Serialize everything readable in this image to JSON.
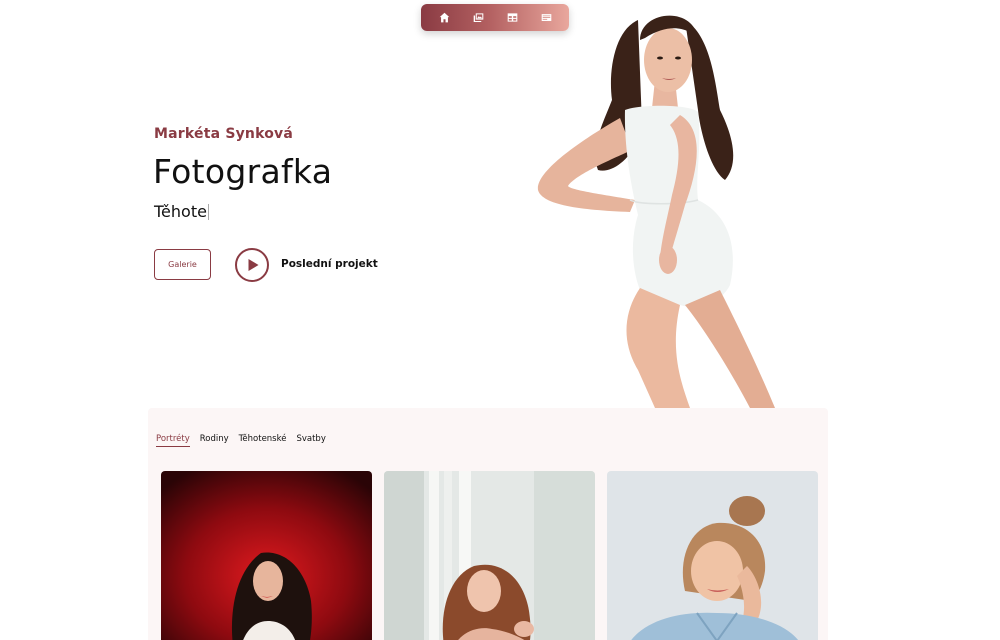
{
  "nav": {
    "items": [
      {
        "icon": "home-icon"
      },
      {
        "icon": "images-icon"
      },
      {
        "icon": "table-icon"
      },
      {
        "icon": "card-icon"
      }
    ],
    "colors": {
      "start": "#8a3b43",
      "end": "#e9a79d"
    }
  },
  "hero": {
    "name": "Markéta Synková",
    "title": "Fotografka",
    "typed_text": "Těhote",
    "gallery_button": "Galerie",
    "play_label": "Poslední projekt"
  },
  "gallery": {
    "tabs": [
      {
        "label": "Portréty",
        "active": true
      },
      {
        "label": "Rodiny",
        "active": false
      },
      {
        "label": "Těhotenské",
        "active": false
      },
      {
        "label": "Svatby",
        "active": false
      }
    ]
  },
  "theme": {
    "accent": "#8a3b43",
    "panel_bg": "#fcf6f6"
  }
}
